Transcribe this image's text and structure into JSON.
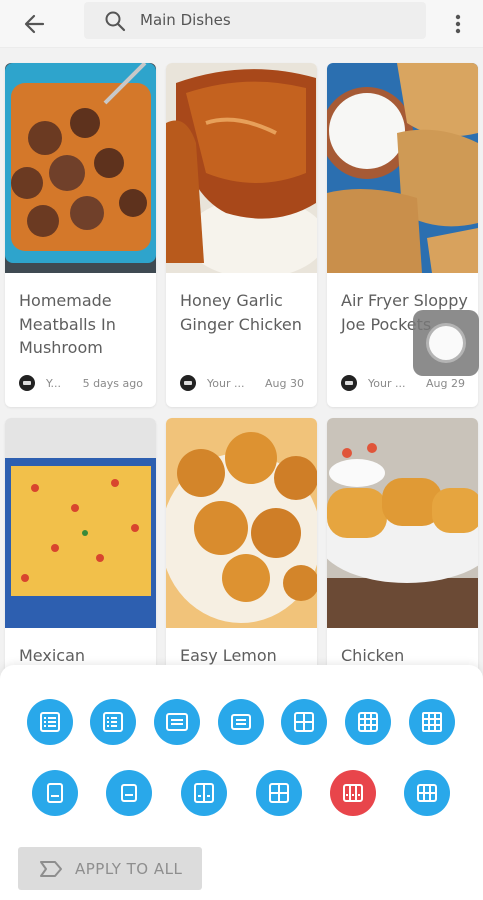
{
  "header": {
    "search_text": "Main Dishes"
  },
  "recipes": [
    {
      "title": "Homemade Meatballs In Mushroom",
      "author": "Y...",
      "date": "5 days ago"
    },
    {
      "title": "Honey Garlic Ginger Chicken",
      "author": "Your ...",
      "date": "Aug 30"
    },
    {
      "title": "Air Fryer Sloppy Joe Pockets",
      "author": "Your ...",
      "date": "Aug 29"
    },
    {
      "title": "Mexican",
      "author": "",
      "date": ""
    },
    {
      "title": "Easy Lemon",
      "author": "",
      "date": ""
    },
    {
      "title": "Chicken",
      "author": "",
      "date": ""
    }
  ],
  "layout_options": {
    "row1": [
      "list-icon",
      "list-small-icon",
      "card-icon",
      "card-small-icon",
      "grid-2x2-icon",
      "grid-3x3-icon",
      "grid-3x3-dense-icon"
    ],
    "row2": [
      "single-card-icon",
      "single-card-small-icon",
      "two-column-icon",
      "two-column-small-icon",
      "three-column-icon",
      "three-column-small-icon"
    ],
    "active": "three-column-icon"
  },
  "apply_button": {
    "label": "APPLY TO ALL"
  },
  "colors": {
    "accent": "#29a8ea",
    "active": "#e8454b"
  }
}
